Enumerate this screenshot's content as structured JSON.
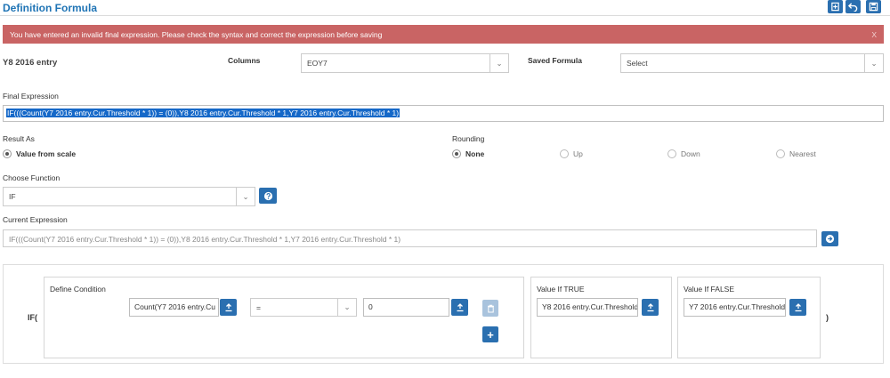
{
  "header": {
    "title": "Definition Formula",
    "toolbar": [
      "add-icon",
      "undo-icon",
      "save-icon"
    ]
  },
  "alert": {
    "message": "You have entered an invalid final expression. Please check the syntax and correct the expression before saving",
    "close": "X",
    "color": "#c96464"
  },
  "entity": "Y8 2016 entry",
  "columns": {
    "label": "Columns",
    "value": "EOY7"
  },
  "saved_formula": {
    "label": "Saved Formula",
    "value": "Select"
  },
  "final_expression": {
    "label": "Final Expression",
    "value": "IF(((Count(Y7 2016 entry.Cur.Threshold * 1)) = (0)),Y8 2016 entry.Cur.Threshold * 1,Y7 2016 entry.Cur.Threshold * 1)"
  },
  "result_as": {
    "label": "Result As",
    "option": "Value from scale"
  },
  "rounding": {
    "label": "Rounding",
    "options": [
      "None",
      "Up",
      "Down",
      "Nearest"
    ],
    "selected": "None"
  },
  "choose_function": {
    "label": "Choose Function",
    "value": "IF"
  },
  "current_expression": {
    "label": "Current Expression",
    "value": "IF(((Count(Y7 2016 entry.Cur.Threshold * 1)) = (0)),Y8 2016 entry.Cur.Threshold * 1,Y7 2016 entry.Cur.Threshold * 1)"
  },
  "builder": {
    "open": "IF(",
    "close": ")",
    "condition": {
      "label": "Define Condition",
      "left": "Count(Y7 2016 entry.Cu",
      "operator": "=",
      "right": "0"
    },
    "value_true": {
      "label": "Value If TRUE",
      "value": "Y8 2016 entry.Cur.Threshold"
    },
    "value_false": {
      "label": "Value If FALSE",
      "value": "Y7 2016 entry.Cur.Threshold"
    }
  },
  "colors": {
    "accent": "#2a6fb0",
    "title": "#1f74b5",
    "selection": "#1568c8"
  }
}
